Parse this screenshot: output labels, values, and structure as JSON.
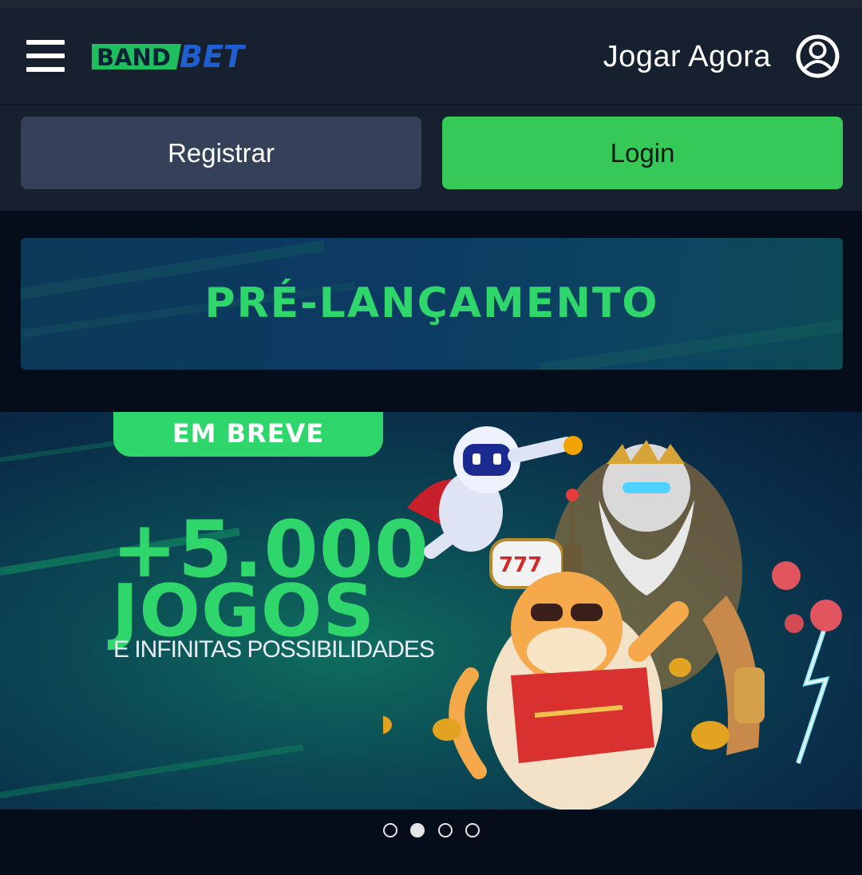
{
  "header": {
    "logo_text_band": "BAND",
    "logo_text_bet": "BET",
    "play_now_label": "Jogar Agora"
  },
  "auth": {
    "register_label": "Registrar",
    "login_label": "Login"
  },
  "promo": {
    "title": "PRÉ-LANÇAMENTO"
  },
  "hero": {
    "badge": "EM BREVE",
    "headline_number": "+5.000",
    "headline_word": "JOGOS",
    "subline": "E INFINITAS POSSIBILIDADES",
    "slot_reels": "777"
  },
  "carousel": {
    "total_slides": 4,
    "active_index": 1
  },
  "colors": {
    "accent_green": "#2ed66b",
    "login_button": "#36c958",
    "register_button": "#354159",
    "header_bg": "#17202f",
    "page_bg": "#050d1a",
    "logo_blue": "#1f5fd1"
  },
  "icons": {
    "menu": "hamburger-menu-icon",
    "user": "user-account-icon"
  }
}
